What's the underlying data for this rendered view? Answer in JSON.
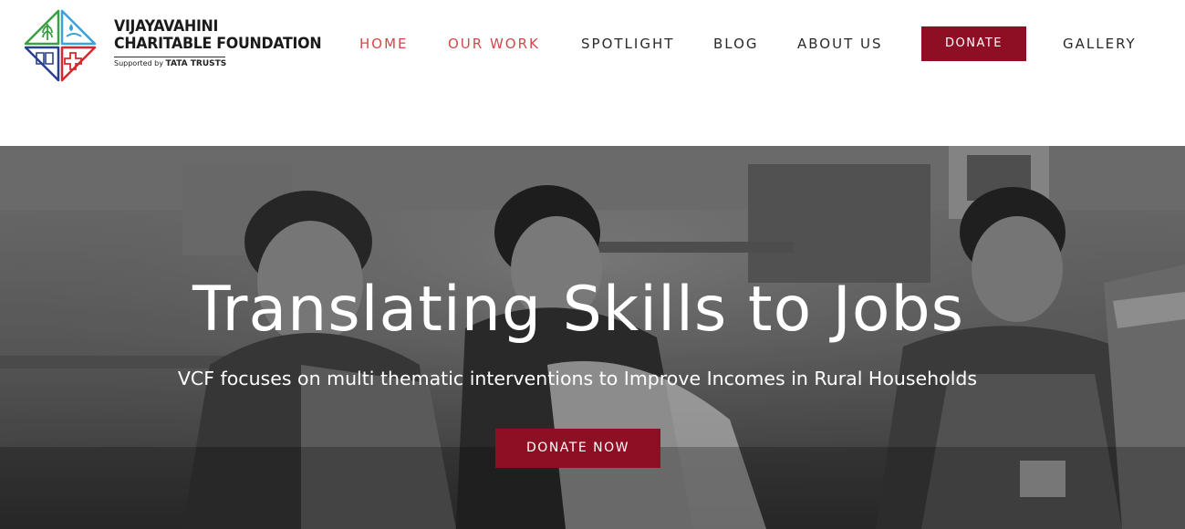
{
  "brand": {
    "name_line1": "VIJAYAVAHINI",
    "name_line2": "CHARITABLE FOUNDATION",
    "supported_by": "Supported by",
    "supporter": "TATA TRUSTS",
    "colors": {
      "green": "#3aa043",
      "blue": "#3aa1db",
      "navy": "#2a3f8f",
      "red": "#d9272e"
    }
  },
  "nav": {
    "items": [
      {
        "label": "HOME",
        "active": true
      },
      {
        "label": "OUR WORK",
        "active": true
      },
      {
        "label": "SPOTLIGHT",
        "active": false
      },
      {
        "label": "BLOG",
        "active": false
      },
      {
        "label": "ABOUT US",
        "active": false
      },
      {
        "label": "GALLERY",
        "active": false
      }
    ],
    "donate_label": "DONATE"
  },
  "hero": {
    "title": "Translating Skills to Jobs",
    "subtitle": "VCF focuses on multi thematic interventions to Improve Incomes in Rural Households",
    "cta_label": "DONATE NOW",
    "image": "grayscale-photo-women-working-textile-workshop"
  },
  "theme": {
    "accent": "#8e0f23",
    "nav_active": "#d04a4a",
    "text_dark": "#2a2a2a"
  }
}
